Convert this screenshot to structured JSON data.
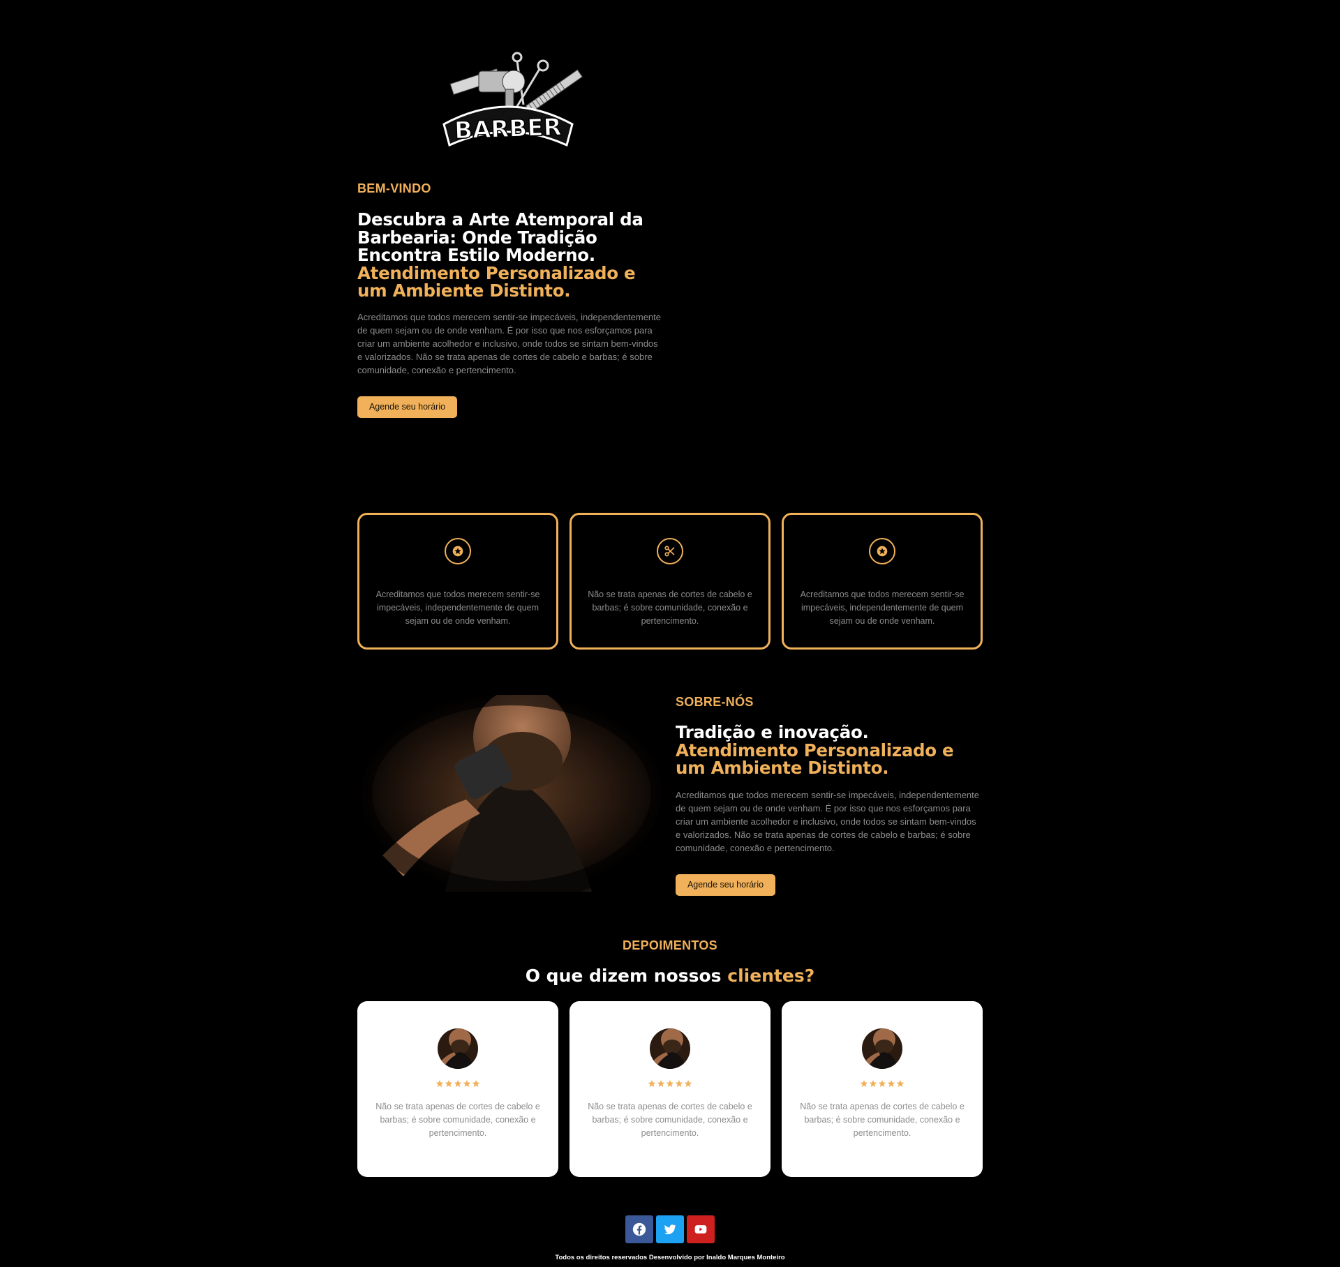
{
  "brand": {
    "logo_text": "BARBER"
  },
  "colors": {
    "accent": "#f0b15a",
    "background": "#000000",
    "facebook": "#3b5998",
    "twitter": "#1da1f2",
    "youtube": "#cd201f"
  },
  "hero": {
    "eyebrow": "BEM-VINDO",
    "title_lines": [
      "Descubra a Arte Atemporal da",
      "Barbearia: Onde Tradição",
      "Encontra Estilo Moderno."
    ],
    "title_accent_lines": [
      "Atendimento Personalizado e",
      "um Ambiente Distinto."
    ],
    "paragraph": "Acreditamos que todos merecem sentir-se impecáveis, independentemente de quem sejam ou de onde venham. É por isso que nos esforçamos para criar um ambiente acolhedor e inclusivo, onde todos se sintam bem-vindos e valorizados. Não se trata apenas de cortes de cabelo e barbas; é sobre comunidade, conexão e pertencimento.",
    "cta": "Agende seu horário"
  },
  "features": [
    {
      "icon": "star-icon",
      "text": "Acreditamos que todos merecem sentir-se impecáveis, independentemente de quem sejam ou de onde venham."
    },
    {
      "icon": "scissors-icon",
      "text": "Não se trata apenas de cortes de cabelo e barbas; é sobre comunidade, conexão e pertencimento."
    },
    {
      "icon": "star-icon",
      "text": "Acreditamos que todos merecem sentir-se impecáveis, independentemente de quem sejam ou de onde venham."
    }
  ],
  "about": {
    "eyebrow": "SOBRE-NÓS",
    "title_line": "Tradição e inovação.",
    "title_accent_lines": [
      "Atendimento Personalizado e",
      "um Ambiente Distinto."
    ],
    "paragraph": "Acreditamos que todos merecem sentir-se impecáveis, independentemente de quem sejam ou de onde venham. É por isso que nos esforçamos para criar um ambiente acolhedor e inclusivo, onde todos se sintam bem-vindos e valorizados. Não se trata apenas de cortes de cabelo e barbas; é sobre comunidade, conexão e pertencimento.",
    "cta": "Agende seu horário"
  },
  "testimonials": {
    "eyebrow": "DEPOIMENTOS",
    "title": "O que dizem nossos",
    "title_accent": "clientes?",
    "items": [
      {
        "rating": 5,
        "text": "Não se trata apenas de cortes de cabelo e barbas; é sobre comunidade, conexão e pertencimento."
      },
      {
        "rating": 5,
        "text": "Não se trata apenas de cortes de cabelo e barbas; é sobre comunidade, conexão e pertencimento."
      },
      {
        "rating": 5,
        "text": "Não se trata apenas de cortes de cabelo e barbas; é sobre comunidade, conexão e pertencimento."
      }
    ]
  },
  "social": [
    {
      "name": "facebook-icon",
      "color": "#3b5998"
    },
    {
      "name": "twitter-icon",
      "color": "#1da1f2"
    },
    {
      "name": "youtube-icon",
      "color": "#cd201f"
    }
  ],
  "footer": {
    "text": "Todos os direitos reservados Desenvolvido por Inaldo Marques Monteiro"
  }
}
